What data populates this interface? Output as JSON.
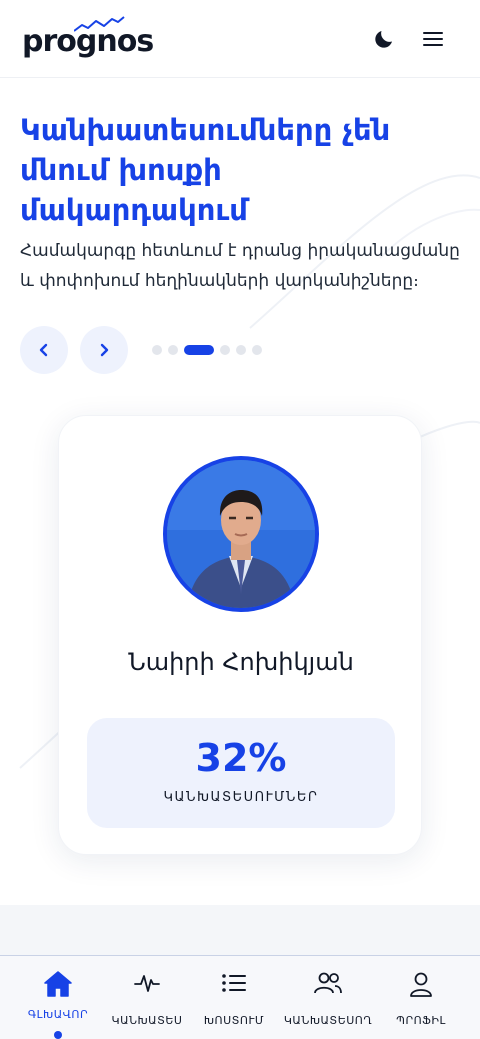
{
  "header": {
    "logo_text": "prognos",
    "theme_icon": "moon-icon",
    "menu_icon": "hamburger-menu-icon"
  },
  "hero": {
    "title": "Կանխատեսումները չեն մնում խոսքի մակարդակում",
    "description": "Համակարգը հետևում է դրանց իրականացմանը և փոփոխում հեղինակների վարկանիշները։",
    "prev_icon": "chevron-left-icon",
    "next_icon": "chevron-right-icon",
    "slides_count": 6,
    "active_slide": 3
  },
  "card": {
    "name": "Նաիրի Հոխիկյան",
    "stat_value": "32%",
    "stat_label": "ԿԱՆԽԱՏԵՍՈՒՄՆԵՐ"
  },
  "bottom_nav": {
    "items": [
      {
        "label": "ԳԼԽԱՎՈՐ",
        "icon": "home-icon",
        "active": true
      },
      {
        "label": "ԿԱՆԽԱՏԵՍ",
        "icon": "pulse-icon",
        "active": false
      },
      {
        "label": "ԽՈՍՏՈՒՄ",
        "icon": "list-icon",
        "active": false
      },
      {
        "label": "ԿԱՆԽԱՏԵՍՈՂ",
        "icon": "users-icon",
        "active": false
      },
      {
        "label": "ՊՐՈՖԻԼ",
        "icon": "user-icon",
        "active": false
      }
    ]
  },
  "colors": {
    "accent": "#1742e6",
    "accent_light": "#eef2fd",
    "text": "#111827"
  }
}
